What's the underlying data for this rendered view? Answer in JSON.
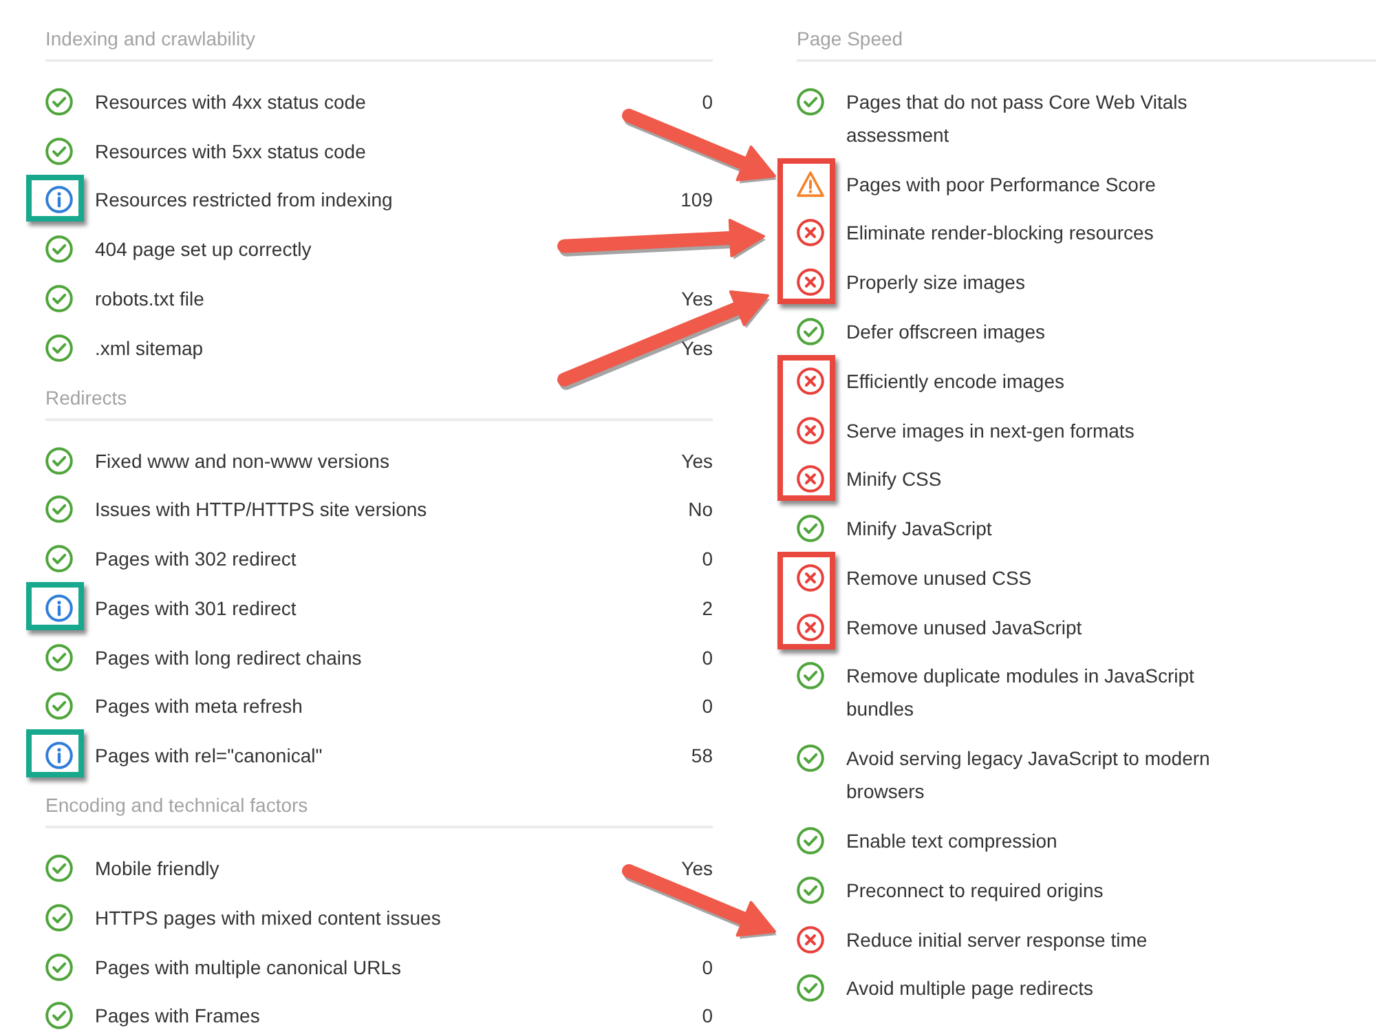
{
  "columns": [
    {
      "color": "#17a88e",
      "sections": [
        {
          "title": "Indexing and crawlability",
          "items": [
            {
              "label": "Resources with 4xx status code",
              "value": "0",
              "kind": "ok",
              "highlighted": false
            },
            {
              "label": "Resources with 5xx status code",
              "kind": "ok",
              "highlighted": false
            },
            {
              "label": "Resources restricted from indexing",
              "value": "109",
              "kind": "info",
              "highlighted": true
            },
            {
              "label": "404 page set up correctly",
              "kind": "ok",
              "highlighted": false
            },
            {
              "label": "robots.txt file",
              "value": "Yes",
              "kind": "ok",
              "highlighted": false
            },
            {
              "label": ".xml sitemap",
              "value": "Yes",
              "kind": "ok",
              "highlighted": false
            }
          ]
        },
        {
          "title": "Redirects",
          "items": [
            {
              "label": "Fixed www and non-www versions",
              "value": "Yes",
              "kind": "ok",
              "highlighted": false
            },
            {
              "label": "Issues with HTTP/HTTPS site versions",
              "value": "No",
              "kind": "ok",
              "highlighted": false
            },
            {
              "label": "Pages with 302 redirect",
              "value": "0",
              "kind": "ok",
              "highlighted": false
            },
            {
              "label": "Pages with 301 redirect",
              "value": "2",
              "kind": "info",
              "highlighted": true
            },
            {
              "label": "Pages with long redirect chains",
              "value": "0",
              "kind": "ok",
              "highlighted": false
            },
            {
              "label": "Pages with meta refresh",
              "value": "0",
              "kind": "ok",
              "highlighted": false
            },
            {
              "label": "Pages with rel=\"canonical\"",
              "value": "58",
              "kind": "info",
              "highlighted": true
            }
          ]
        },
        {
          "title": "Encoding and technical factors",
          "items": [
            {
              "label": "Mobile friendly",
              "value": "Yes",
              "kind": "ok",
              "highlighted": false
            },
            {
              "label": "HTTPS pages with mixed content issues",
              "kind": "ok",
              "highlighted": false
            },
            {
              "label": "Pages with multiple canonical URLs",
              "value": "0",
              "kind": "ok",
              "highlighted": false
            },
            {
              "label": "Pages with Frames",
              "value": "0",
              "kind": "ok",
              "highlighted": false
            }
          ]
        }
      ]
    },
    {
      "color": "#e8483d",
      "sections": [
        {
          "title": "Page Speed",
          "items": [
            {
              "label": "Pages that do not pass Core Web Vitals assessment",
              "kind": "ok",
              "highlighted": false
            },
            {
              "label": "Pages with poor Performance Score",
              "kind": "warning",
              "highlighted": true,
              "arrow": {
                "kind": "from-upper-left"
              }
            },
            {
              "label": "Eliminate render-blocking resources",
              "kind": "error",
              "highlighted": true,
              "arrow": {
                "kind": "from-left"
              }
            },
            {
              "label": "Properly size images",
              "kind": "error",
              "highlighted": true,
              "arrow": {
                "kind": "from-lower-left"
              }
            },
            {
              "label": "Defer offscreen images",
              "kind": "ok",
              "highlighted": false
            },
            {
              "label": "Efficiently encode images",
              "kind": "error",
              "highlighted": true
            },
            {
              "label": "Serve images in next-gen formats",
              "kind": "error",
              "highlighted": true
            },
            {
              "label": "Minify CSS",
              "kind": "error",
              "highlighted": true
            },
            {
              "label": "Minify JavaScript",
              "kind": "ok",
              "highlighted": false
            },
            {
              "label": "Remove unused CSS",
              "kind": "error",
              "highlighted": true
            },
            {
              "label": "Remove unused JavaScript",
              "kind": "error",
              "highlighted": true
            },
            {
              "label": "Remove duplicate modules in JavaScript bundles",
              "kind": "ok",
              "highlighted": false
            },
            {
              "label": "Avoid serving legacy JavaScript to modern browsers",
              "kind": "ok",
              "highlighted": false
            },
            {
              "label": "Enable text compression",
              "kind": "ok",
              "highlighted": false
            },
            {
              "label": "Preconnect to required origins",
              "kind": "ok",
              "highlighted": false
            },
            {
              "label": "Reduce initial server response time",
              "kind": "error",
              "highlighted": false,
              "arrow": {
                "kind": "from-upper-left"
              }
            },
            {
              "label": "Avoid multiple page redirects",
              "kind": "ok",
              "highlighted": false
            }
          ]
        }
      ]
    }
  ]
}
